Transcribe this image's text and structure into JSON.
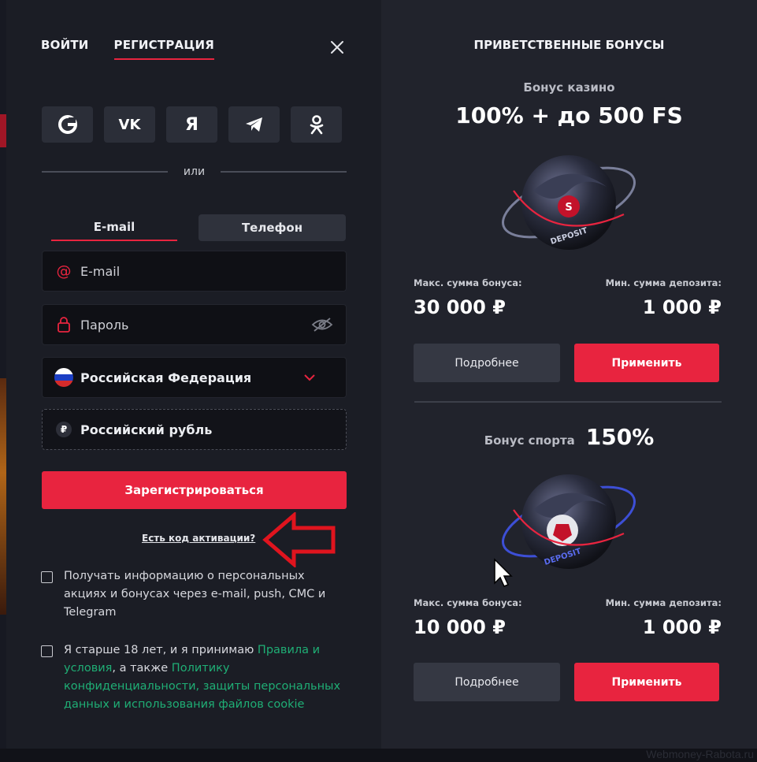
{
  "auth": {
    "tabs": [
      {
        "label": "ВОЙТИ"
      },
      {
        "label": "РЕГИСТРАЦИЯ"
      }
    ],
    "social": [
      "G",
      "VK",
      "Я",
      "telegram",
      "ok"
    ],
    "or_label": "или",
    "method_tabs": [
      {
        "label": "E-mail"
      },
      {
        "label": "Телефон"
      }
    ],
    "email_placeholder": "E-mail",
    "password_placeholder": "Пароль",
    "country": "Российская Федерация",
    "currency": "Российский рубль",
    "currency_symbol": "₽",
    "submit_label": "Зарегистрироваться",
    "activation_link": "Есть код активации?",
    "consent_marketing": "Получать информацию о персональных акциях и бонусах через e-mail, push, СМС и Telegram",
    "consent_age_prefix": "Я старше 18 лет, и я принимаю ",
    "consent_rules_link": "Правила и условия",
    "consent_age_middle": ", а также ",
    "consent_policy_link": "Политику конфиденциальности, защиты персональных данных и использования файлов cookie"
  },
  "bonuses": {
    "heading": "ПРИВЕТСТВЕННЫЕ БОНУСЫ",
    "casino": {
      "subtitle": "Бонус казино",
      "amount": "100% + до 500 FS",
      "max_label": "Макс. сумма бонуса:",
      "max_value": "30 000 ₽",
      "min_label": "Мин. сумма депозита:",
      "min_value": "1 000 ₽",
      "details_label": "Подробнее",
      "apply_label": "Применить"
    },
    "sport": {
      "subtitle": "Бонус спорта",
      "amount": "150%",
      "max_label": "Макс. сумма бонуса:",
      "max_value": "10 000 ₽",
      "min_label": "Мин. сумма депозита:",
      "min_value": "1 000 ₽",
      "details_label": "Подробнее",
      "apply_label": "Применить"
    },
    "art_ring_text": "DEPOSIT",
    "art_badge": "S"
  },
  "watermark": "Webmoney-Rabota.ru",
  "colors": {
    "accent": "#e8243f",
    "link_green": "#1fae75",
    "left_bg": "#1b1d25",
    "right_bg": "#21232c"
  }
}
